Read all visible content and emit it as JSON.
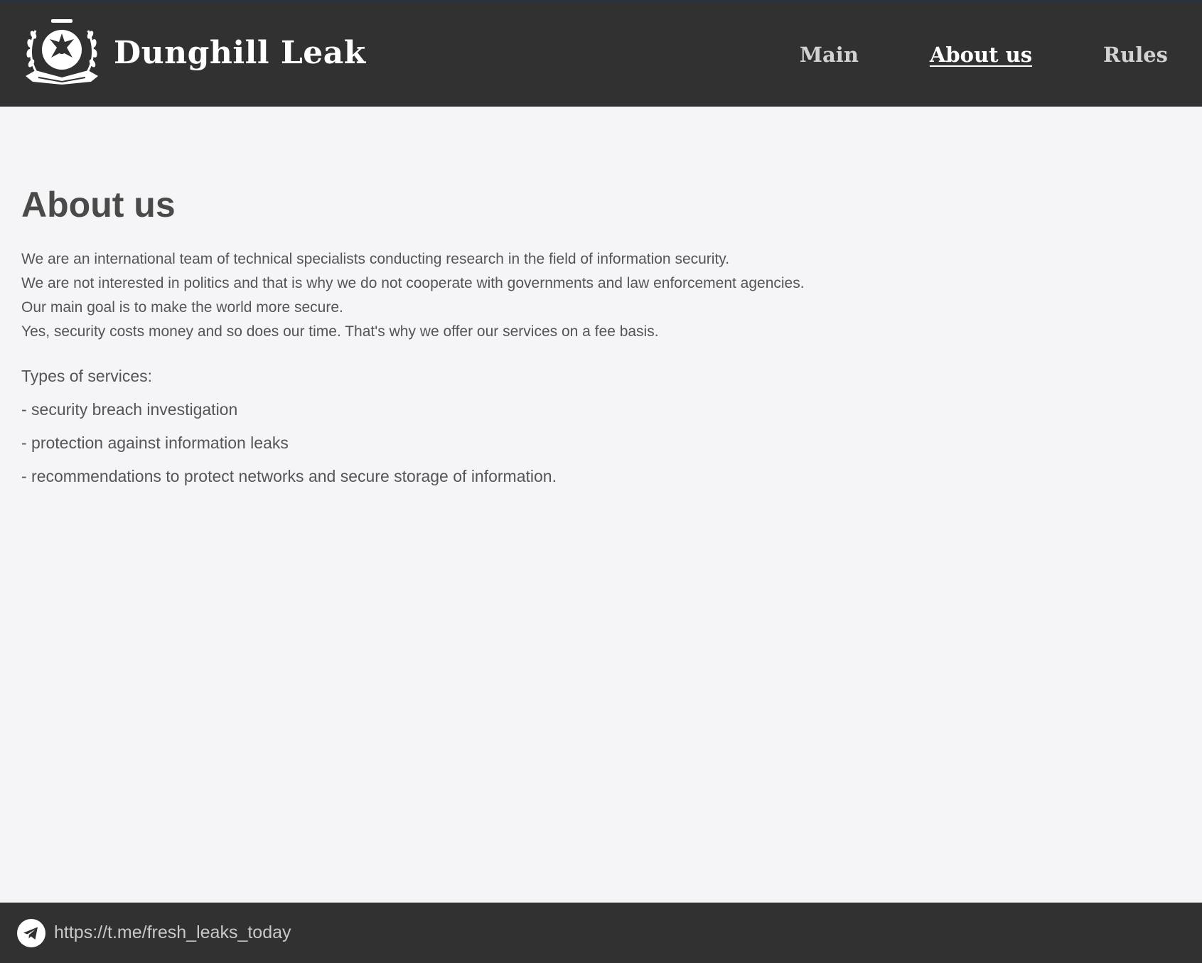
{
  "header": {
    "brand_name": "Dunghill Leak",
    "logo_icon": "laurel-wreath-emblem-logo",
    "nav": [
      {
        "label": "Main",
        "active": false
      },
      {
        "label": "About us",
        "active": true
      },
      {
        "label": "Rules",
        "active": false
      }
    ]
  },
  "main": {
    "title": "About us",
    "intro_lines": [
      "We are an international team of technical specialists conducting research in the field of information security.",
      "We are not interested in politics and that is why we do not cooperate with governments and law enforcement agencies.",
      "Our main goal is to make the world more secure.",
      "Yes, security costs money and so does our time. That's why we offer our services on a fee basis."
    ],
    "services_heading": "Types of services:",
    "services": [
      "- security breach investigation",
      "- protection against information leaks",
      "- recommendations to protect networks and secure storage of information."
    ]
  },
  "footer": {
    "link_icon": "telegram-icon",
    "link_text": "https://t.me/fresh_leaks_today"
  },
  "colors": {
    "header_bg": "#313131",
    "page_bg": "#f5f5f7",
    "text": "#555555",
    "nav_text": "#d2d2d2",
    "active_nav_text": "#ffffff"
  }
}
